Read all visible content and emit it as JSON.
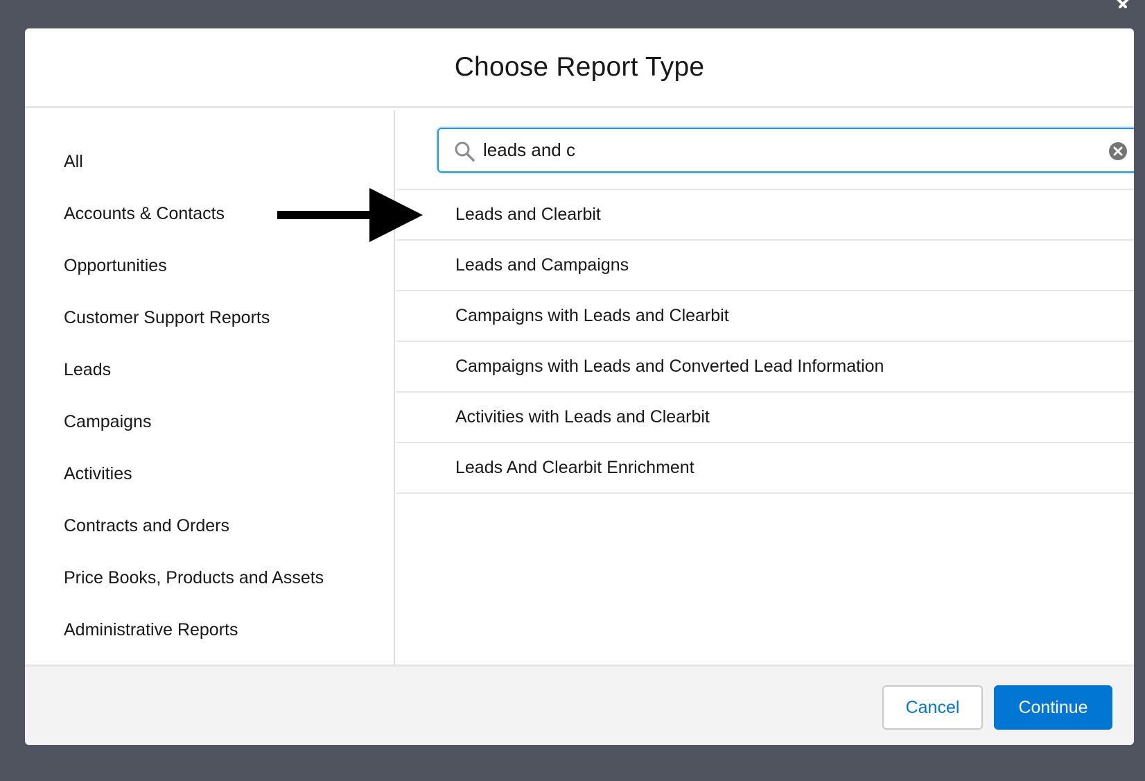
{
  "modal": {
    "title": "Choose Report Type"
  },
  "sidebar": {
    "items": [
      {
        "label": "All"
      },
      {
        "label": "Accounts & Contacts"
      },
      {
        "label": "Opportunities"
      },
      {
        "label": "Customer Support Reports"
      },
      {
        "label": "Leads"
      },
      {
        "label": "Campaigns"
      },
      {
        "label": "Activities"
      },
      {
        "label": "Contracts and Orders"
      },
      {
        "label": "Price Books, Products and Assets"
      },
      {
        "label": "Administrative Reports"
      }
    ]
  },
  "search": {
    "value": "leads and c",
    "icon": "search-icon",
    "clear_icon": "clear-icon"
  },
  "results": {
    "items": [
      {
        "label": "Leads and Clearbit"
      },
      {
        "label": "Leads and Campaigns"
      },
      {
        "label": "Campaigns with Leads and Clearbit"
      },
      {
        "label": "Campaigns with Leads and Converted Lead Information"
      },
      {
        "label": "Activities with Leads and Clearbit"
      },
      {
        "label": "Leads And Clearbit Enrichment"
      }
    ]
  },
  "footer": {
    "cancel_label": "Cancel",
    "continue_label": "Continue"
  },
  "colors": {
    "backdrop": "#50545e",
    "brand": "#0176d3",
    "focus_border": "#1b96ff",
    "footer_bg": "#f3f3f3"
  }
}
